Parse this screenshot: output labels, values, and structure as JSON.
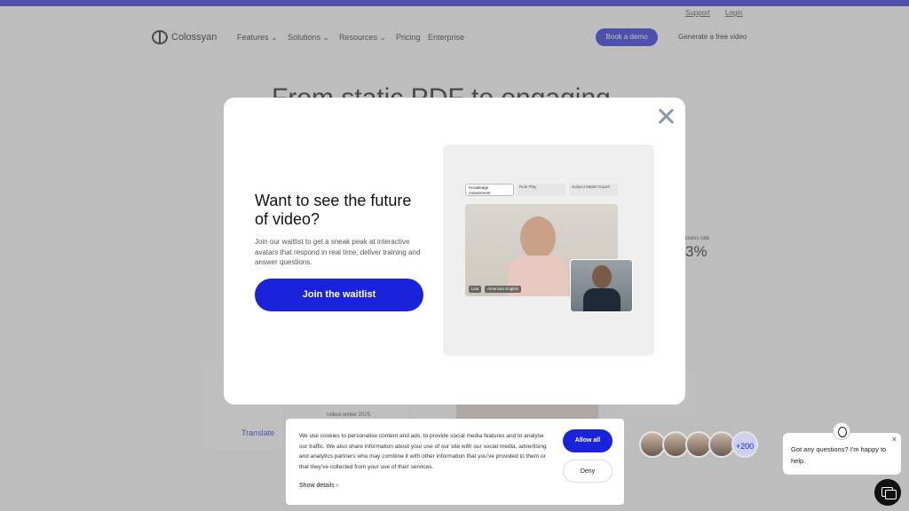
{
  "header": {
    "support_link": "Support",
    "login_link": "Login",
    "logo_text": "Colossyan",
    "nav": [
      "Features",
      "Solutions",
      "Resources",
      "Pricing",
      "Enterprise"
    ],
    "demo_button": "Book a demo",
    "generate_link": "Generate a free video"
  },
  "hero": {
    "title": "From static PDF to engaging"
  },
  "background": {
    "stat_label": "ccess rate",
    "stat_value": "3%",
    "translate_button": "Translate",
    "card_text": "rollout winter 2025"
  },
  "modal": {
    "title": "Want to see the future of video?",
    "description": "Join our waitlist to get a sneak peak at interactive avatars that respond in real time, deliver training and answer questions.",
    "cta": "Join the waitlist",
    "preview": {
      "tabs": [
        "Knowledge Assessment",
        "Role Play",
        "Subject Matter Expert"
      ],
      "video_name": "Lisa",
      "video_language": "American English"
    }
  },
  "cookie": {
    "text": "We use cookies to personalise content and ads, to provide social media features and to analyse our traffic. We also share information about your use of our site with our social media, advertising and analytics partners who may combine it with other information that you've provided to them or that they've collected from your use of their services.",
    "details_link": "Show details",
    "allow_button": "Allow all",
    "deny_button": "Deny"
  },
  "avatars": {
    "count_label": "+200"
  },
  "chat": {
    "message": "Got any questions? I'm happy to help."
  },
  "colors": {
    "brand": "#1a23d9"
  }
}
